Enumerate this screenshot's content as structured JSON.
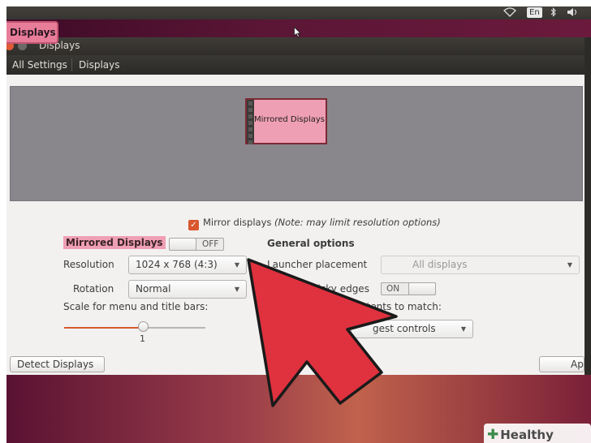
{
  "panel": {
    "wifi_icon": "wifi-icon",
    "lang": "En",
    "bluetooth_icon": "bluetooth-icon",
    "volume_icon": "volume-icon"
  },
  "launcher": {
    "label": "Displays"
  },
  "window": {
    "title": "Displays"
  },
  "nav": {
    "all_settings": "All Settings",
    "current": "Displays"
  },
  "arrangement": {
    "monitor_label": "Mirrored Displays"
  },
  "mirror": {
    "label": "Mirror displays",
    "note": "(Note: may limit resolution options)",
    "checked": true
  },
  "left": {
    "display_name": "Mirrored Displays",
    "toggle_state": "OFF",
    "resolution_label": "Resolution",
    "resolution_value": "1024 x 768 (4:3)",
    "rotation_label": "Rotation",
    "rotation_value": "Normal",
    "scale_label": "Scale for menu and title bars:",
    "scale_value": "1",
    "scale_fraction": 0.55
  },
  "right": {
    "heading": "General options",
    "launcher_label": "Launcher placement",
    "launcher_value": "All displays",
    "sticky_label": "Sticky edges",
    "sticky_state": "ON",
    "scale_contents_label": "contents to match:",
    "scale_contents_value": "gest controls"
  },
  "buttons": {
    "detect": "Detect Displays",
    "apply": "Ap"
  },
  "colors": {
    "accent": "#d9572e",
    "highlight": "#ef9fb4",
    "arrow": "#e0313e"
  },
  "watermark": {
    "text": "Healthy Living"
  }
}
